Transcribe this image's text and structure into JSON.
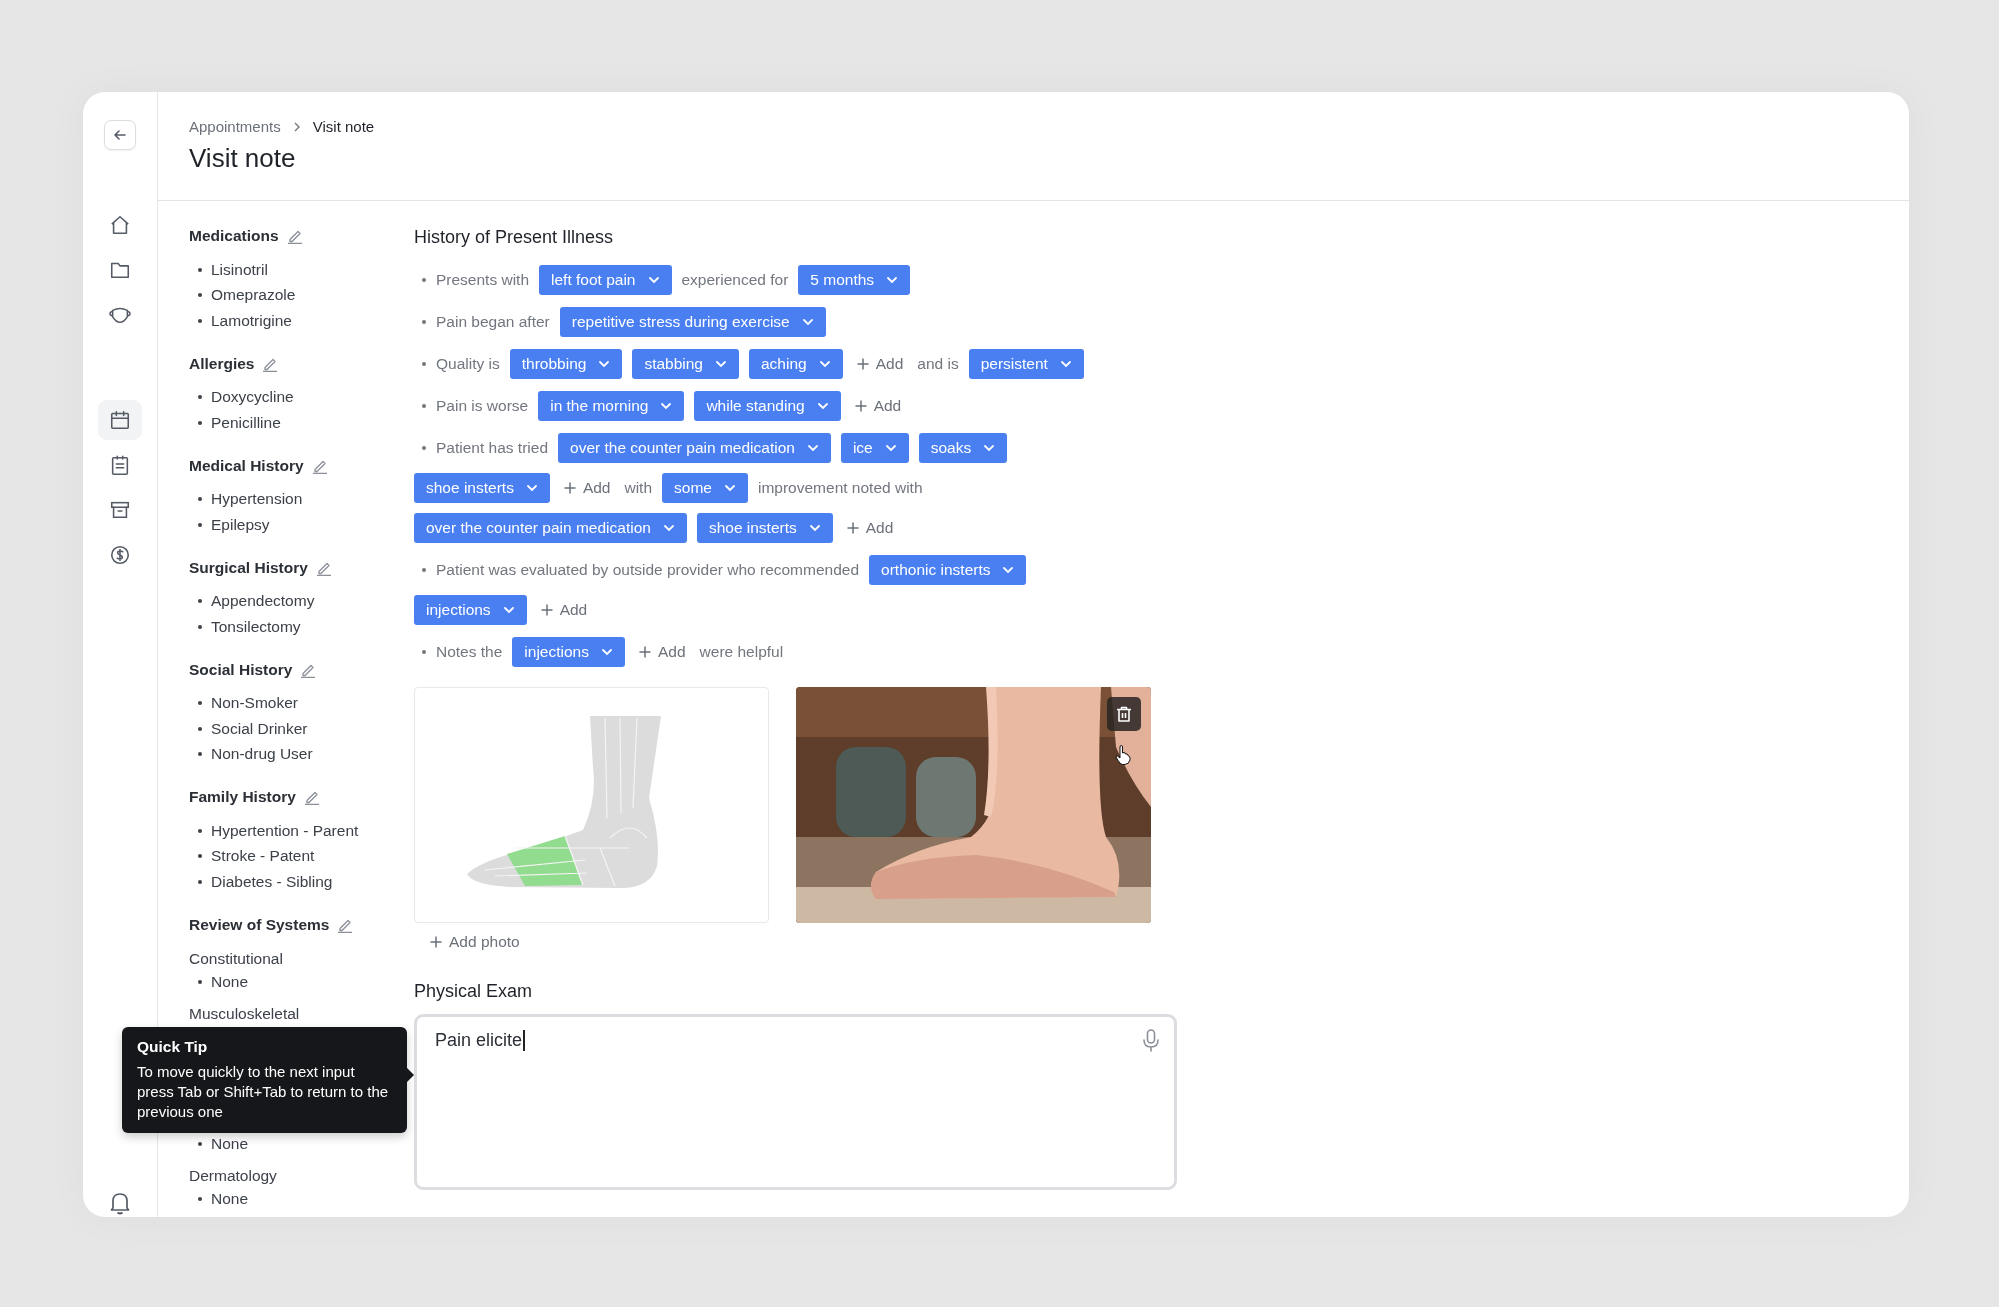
{
  "sidebar": {
    "nav_items": [
      {
        "kind": "home",
        "selected": false
      },
      {
        "kind": "folder",
        "selected": false
      },
      {
        "kind": "mask",
        "selected": false
      },
      {
        "kind": "calendar",
        "selected": true
      },
      {
        "kind": "clipboard",
        "selected": false
      },
      {
        "kind": "archive",
        "selected": false
      },
      {
        "kind": "dollar",
        "selected": false
      }
    ]
  },
  "breadcrumb": [
    {
      "label": "Appointments",
      "current": false
    },
    {
      "label": "Visit note",
      "current": true
    }
  ],
  "title": "Visit note",
  "summary_sections": [
    {
      "title": "Medications",
      "items": [
        "Lisinotril",
        "Omeprazole",
        "Lamotrigine"
      ]
    },
    {
      "title": "Allergies",
      "items": [
        "Doxycycline",
        "Penicilline"
      ]
    },
    {
      "title": "Medical History",
      "items": [
        "Hypertension",
        "Epilepsy"
      ]
    },
    {
      "title": "Surgical History",
      "items": [
        "Appendectomy",
        "Tonsilectomy"
      ]
    },
    {
      "title": "Social History",
      "items": [
        "Non-Smoker",
        "Social Drinker",
        "Non-drug User"
      ]
    },
    {
      "title": "Family History",
      "items": [
        "Hypertention - Parent",
        "Stroke - Patent",
        "Diabetes - Sibling"
      ]
    },
    {
      "title": "Review of Systems",
      "groups": [
        {
          "label": "Constitutional",
          "items": [
            "None"
          ]
        },
        {
          "label": "Musculoskeletal"
        },
        {
          "items": [
            "None"
          ]
        },
        {
          "label": "Dermatology",
          "items": [
            "None"
          ]
        }
      ]
    }
  ],
  "hpi": {
    "title": "History of Present Illness",
    "items": [
      {
        "parts": [
          {
            "kind": "text",
            "text": "Presents with"
          },
          {
            "kind": "chip",
            "text": "left foot pain"
          },
          {
            "kind": "text",
            "text": "experienced for"
          },
          {
            "kind": "chip",
            "text": "5 months"
          }
        ]
      },
      {
        "parts": [
          {
            "kind": "text",
            "text": "Pain began after"
          },
          {
            "kind": "chip",
            "text": "repetitive stress during exercise"
          }
        ]
      },
      {
        "parts": [
          {
            "kind": "text",
            "text": "Quality is"
          },
          {
            "kind": "chip",
            "text": "throbbing"
          },
          {
            "kind": "chip",
            "text": "stabbing"
          },
          {
            "kind": "chip",
            "text": "aching"
          },
          {
            "kind": "add",
            "text": "Add"
          },
          {
            "kind": "text",
            "text": "and is"
          },
          {
            "kind": "chip",
            "text": "persistent"
          }
        ]
      },
      {
        "parts": [
          {
            "kind": "text",
            "text": "Pain is worse"
          },
          {
            "kind": "chip",
            "text": "in the morning"
          },
          {
            "kind": "chip",
            "text": "while standing"
          },
          {
            "kind": "add",
            "text": "Add"
          }
        ]
      },
      {
        "parts": [
          {
            "kind": "text",
            "text": "Patient has tried"
          },
          {
            "kind": "chip",
            "text": "over the counter pain medication"
          },
          {
            "kind": "chip",
            "text": "ice"
          },
          {
            "kind": "chip",
            "text": "soaks"
          },
          {
            "kind": "break"
          },
          {
            "kind": "chip",
            "text": "shoe insterts"
          },
          {
            "kind": "add",
            "text": "Add"
          },
          {
            "kind": "text",
            "text": "with"
          },
          {
            "kind": "chip",
            "text": "some"
          },
          {
            "kind": "text",
            "text": "improvement noted with"
          },
          {
            "kind": "break"
          },
          {
            "kind": "chip",
            "text": "over the counter pain medication"
          },
          {
            "kind": "chip",
            "text": "shoe insterts"
          },
          {
            "kind": "add",
            "text": "Add"
          }
        ]
      },
      {
        "parts": [
          {
            "kind": "text",
            "text": "Patient was evaluated by outside provider who recommended"
          },
          {
            "kind": "chip",
            "text": "orthonic insterts"
          },
          {
            "kind": "break"
          },
          {
            "kind": "chip",
            "text": "injections"
          },
          {
            "kind": "add",
            "text": "Add"
          }
        ]
      },
      {
        "parts": [
          {
            "kind": "text",
            "text": "Notes the"
          },
          {
            "kind": "chip",
            "text": "injections"
          },
          {
            "kind": "add",
            "text": "Add"
          },
          {
            "kind": "text",
            "text": "were helpful"
          }
        ]
      }
    ]
  },
  "photos": [
    {
      "kind": "diagram"
    },
    {
      "kind": "picture"
    }
  ],
  "add_photo": "Add photo",
  "physical_exam": {
    "title": "Physical Exam",
    "value": "Pain elicite"
  },
  "tooltip": {
    "title": "Quick Tip",
    "text": "To move quickly to the next input press Tab or Shift+Tab to return to the previous one"
  }
}
